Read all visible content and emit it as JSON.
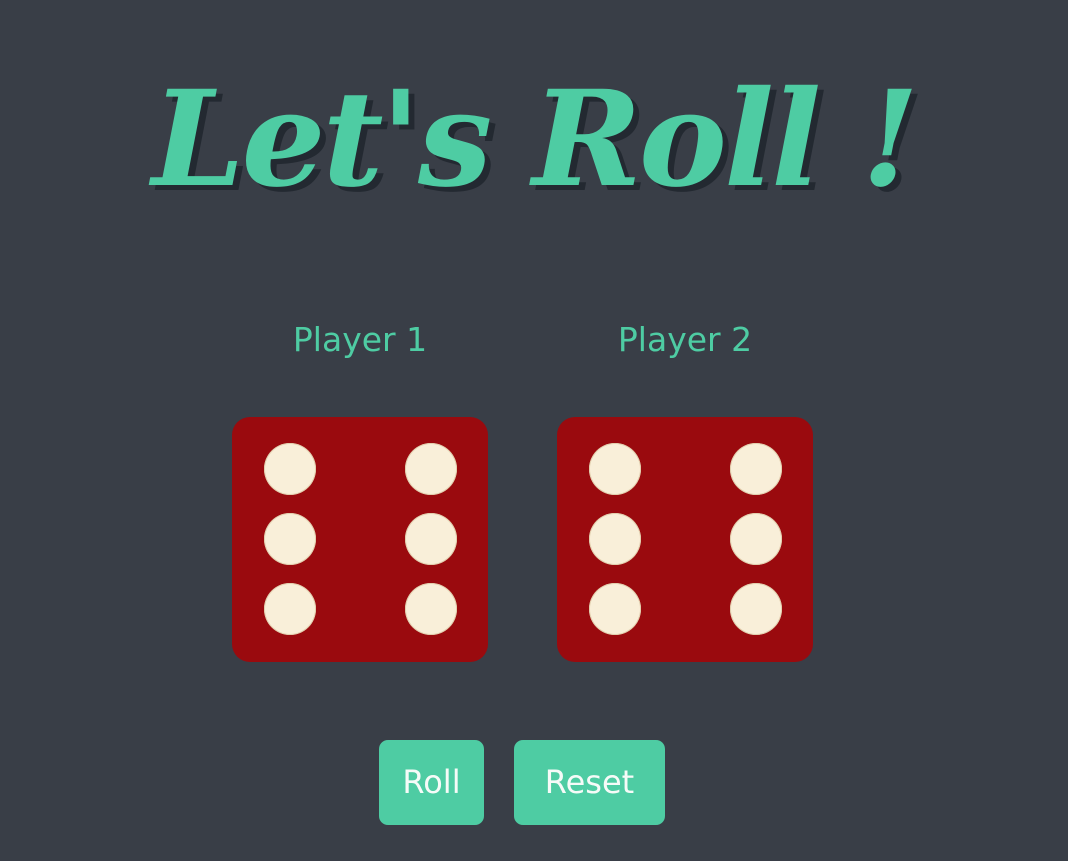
{
  "title": "Let's Roll !",
  "players": [
    {
      "label": "Player 1",
      "die_value": 6
    },
    {
      "label": "Player 2",
      "die_value": 6
    }
  ],
  "controls": {
    "roll_label": "Roll",
    "reset_label": "Reset"
  },
  "colors": {
    "background": "#393e47",
    "accent": "#4ecca3",
    "die_face": "#9a0a0e",
    "pip": "#f9efd9",
    "button_text": "#f6fbf8"
  }
}
